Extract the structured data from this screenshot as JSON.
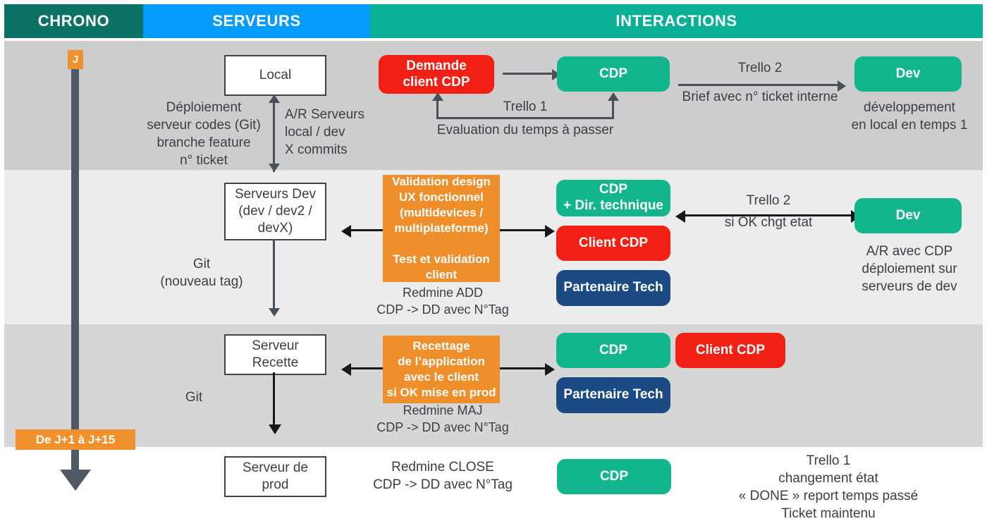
{
  "header": {
    "columns": [
      {
        "label": "CHRONO",
        "color": "#0b7265"
      },
      {
        "label": "SERVEURS",
        "color": "#039bfc"
      },
      {
        "label": "INTERACTIONS",
        "color": "#0ab096"
      }
    ]
  },
  "chrono": {
    "start_marker": "J",
    "range_marker": "De J+1  à J+15"
  },
  "row1": {
    "server_box": "Local",
    "deploy_note": "Déploiement\nserveur codes (Git)\nbranche feature\nn° ticket",
    "ar_note": "A/R Serveurs\nlocal / dev\nX commits",
    "demande_pill": "Demande\nclient CDP",
    "cdp_pill": "CDP",
    "trello1_label": "Trello 1",
    "evaluation_label": "Evaluation du temps à passer",
    "trello2_top": "Trello 2",
    "trello2_bottom": "Brief avec n° ticket interne",
    "dev_pill": "Dev",
    "dev_note": "développement\nen local en temps 1"
  },
  "row2": {
    "server_box": "Serveurs Dev\n(dev / dev2 /\ndevX)",
    "git_note": "Git\n(nouveau tag)",
    "orange_box": "Validation design\nUX fonctionnel\n(multidevices /\nmultiplateforme)\n\nTest et validation\nclient",
    "redmine_note": "Redmine ADD\nCDP -> DD avec N°Tag",
    "pills": [
      {
        "label": "CDP\n+ Dir. technique",
        "color": "green"
      },
      {
        "label": "Client CDP",
        "color": "red"
      },
      {
        "label": "Partenaire Tech",
        "color": "navy"
      }
    ],
    "trello2_top": "Trello 2",
    "trello2_bottom": "si OK chgt etat",
    "dev_pill": "Dev",
    "dev_note": "A/R avec CDP\ndéploiement sur\nserveurs de dev"
  },
  "row3": {
    "server_box": "Serveur\nRecette",
    "git_note": "Git",
    "orange_box": "Recettage\nde l’application\navec le client\nsi OK mise en prod",
    "redmine_note": "Redmine MAJ\nCDP -> DD avec N°Tag",
    "pills": [
      {
        "label": "CDP",
        "color": "green"
      },
      {
        "label": "Client CDP",
        "color": "red"
      },
      {
        "label": "Partenaire Tech",
        "color": "navy"
      }
    ]
  },
  "row4": {
    "server_box": "Serveur de\nprod",
    "redmine_note": "Redmine CLOSE\nCDP -> DD avec N°Tag",
    "cdp_pill": "CDP",
    "final_note": "Trello 1\nchangement état\n« DONE » report temps passé\nTicket maintenu"
  },
  "colors": {
    "chrono": "#0b7265",
    "serveurs": "#039bfc",
    "interactions": "#0ab096",
    "green": "#13b68c",
    "red": "#f02015",
    "navy": "#1c4a85",
    "orange": "#ef8f2c",
    "timeline": "#4f5a66"
  }
}
